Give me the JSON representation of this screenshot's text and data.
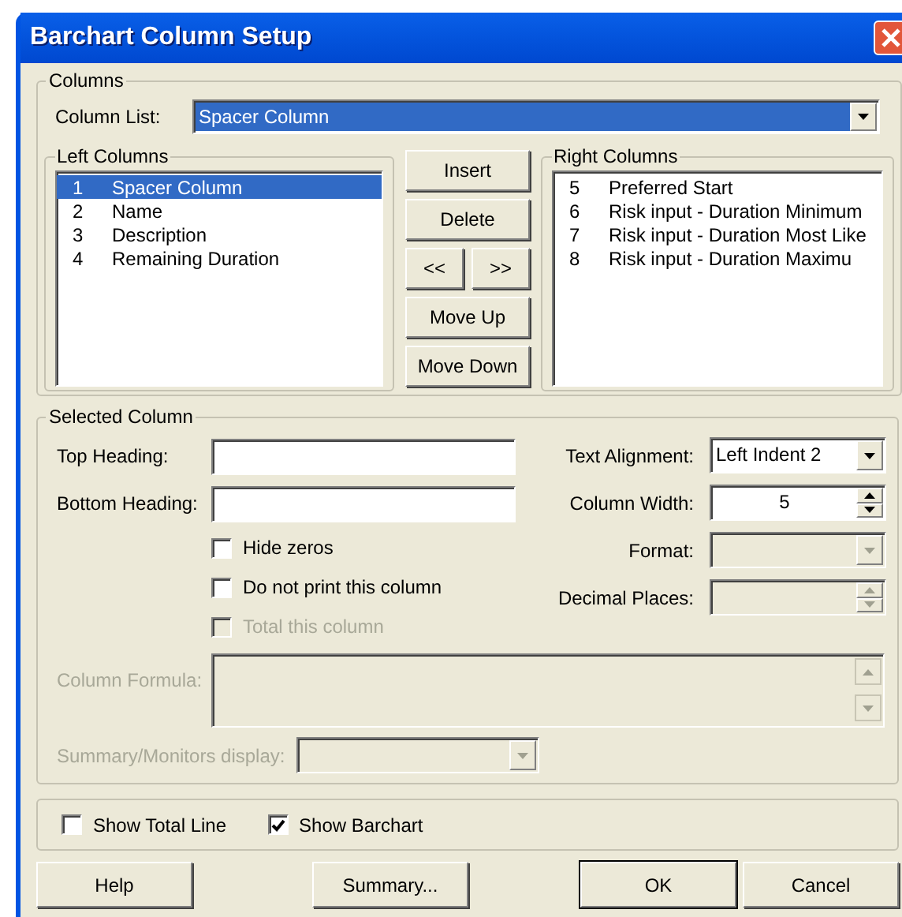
{
  "window": {
    "title": "Barchart Column Setup"
  },
  "columns_group": {
    "title": "Columns",
    "column_list": {
      "label": "Column List:",
      "value": "Spacer Column"
    },
    "left_columns": {
      "title": "Left Columns",
      "items": [
        {
          "number": "1",
          "name": "Spacer Column",
          "selected": true
        },
        {
          "number": "2",
          "name": "Name",
          "selected": false
        },
        {
          "number": "3",
          "name": "Description",
          "selected": false
        },
        {
          "number": "4",
          "name": "Remaining Duration",
          "selected": false
        }
      ]
    },
    "buttons": [
      {
        "label": "Insert"
      },
      {
        "label": "Delete"
      },
      {
        "label": "<<"
      },
      {
        "label": ">>"
      },
      {
        "label": "Move Up"
      },
      {
        "label": "Move Down"
      }
    ],
    "right_columns": {
      "title": "Right Columns",
      "items": [
        {
          "number": "5",
          "name": "Preferred Start",
          "selected": false
        },
        {
          "number": "6",
          "name": "Risk input - Duration Minimum",
          "selected": false
        },
        {
          "number": "7",
          "name": "Risk input - Duration Most Like",
          "selected": false
        },
        {
          "number": "8",
          "name": "Risk input - Duration Maximu",
          "selected": false
        }
      ]
    }
  },
  "selected_column": {
    "title": "Selected Column",
    "top_heading": {
      "label": "Top Heading:"
    },
    "bottom_heading": {
      "label": "Bottom Heading:"
    },
    "checkboxes": [
      {
        "label": "Hide zeros",
        "checked": false,
        "disabled": false
      },
      {
        "label": "Do not print this column",
        "checked": false,
        "disabled": false
      },
      {
        "label": "Total this column",
        "checked": false,
        "disabled": true
      }
    ],
    "text_alignment": {
      "label": "Text Alignment:",
      "value": "Left Indent 2",
      "disabled": false
    },
    "column_width": {
      "label": "Column Width:",
      "value": "5",
      "disabled": false
    },
    "format": {
      "label": "Format:",
      "disabled": true
    },
    "decimal_places": {
      "label": "Decimal Places:",
      "disabled": true
    },
    "column_formula": {
      "label": "Column Formula:",
      "disabled": true
    },
    "summary_display": {
      "label": "Summary/Monitors display:",
      "disabled": true
    }
  },
  "options": [
    {
      "label": "Show Total Line",
      "checked": false
    },
    {
      "label": "Show Barchart",
      "checked": true
    }
  ],
  "buttons": [
    {
      "label": "Help",
      "default": false
    },
    {
      "label": "Summary...",
      "default": false
    },
    {
      "label": "OK",
      "default": true
    },
    {
      "label": "Cancel",
      "default": false
    }
  ]
}
